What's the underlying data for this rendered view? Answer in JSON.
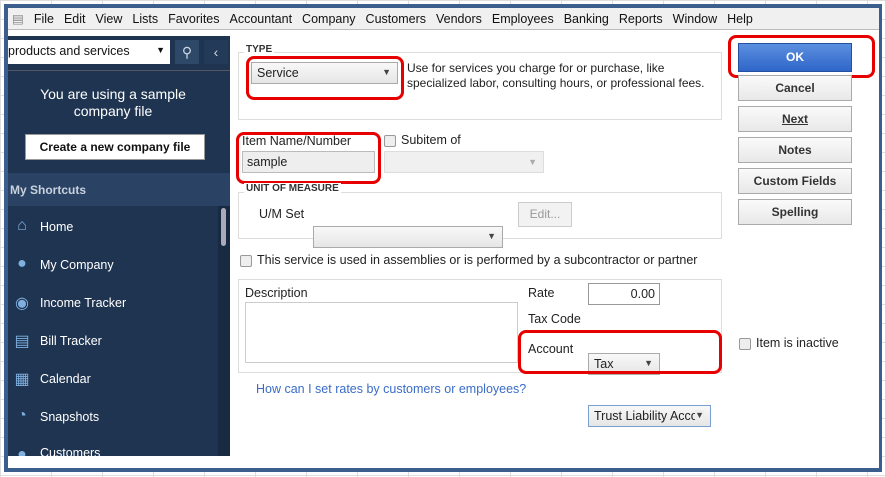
{
  "menu": [
    "File",
    "Edit",
    "View",
    "Lists",
    "Favorites",
    "Accountant",
    "Company",
    "Customers",
    "Vendors",
    "Employees",
    "Banking",
    "Reports",
    "Window",
    "Help"
  ],
  "sidebar": {
    "search_value": "products and services",
    "sample_msg": "You are using a sample company file",
    "create_btn": "Create a new company file",
    "shortcuts_title": "My Shortcuts",
    "items": [
      {
        "label": "Home",
        "icon": "home-icon"
      },
      {
        "label": "My Company",
        "icon": "company-icon"
      },
      {
        "label": "Income Tracker",
        "icon": "income-icon"
      },
      {
        "label": "Bill Tracker",
        "icon": "bill-icon"
      },
      {
        "label": "Calendar",
        "icon": "calendar-icon"
      },
      {
        "label": "Snapshots",
        "icon": "pie-icon"
      },
      {
        "label": "Customers",
        "icon": "customers-icon"
      }
    ]
  },
  "form": {
    "type_label": "TYPE",
    "type_value": "Service",
    "type_desc": "Use for services you charge for or purchase, like specialized labor, consulting hours, or professional fees.",
    "item_name_label": "Item Name/Number",
    "item_name_value": "sample",
    "subitem_label": "Subitem of",
    "uom_label": "UNIT OF MEASURE",
    "um_set_label": "U/M Set",
    "edit_btn": "Edit...",
    "assemblies_label": "This service is used in assemblies or is performed by a subcontractor or partner",
    "description_label": "Description",
    "rate_label": "Rate",
    "rate_value": "0.00",
    "tax_code_label": "Tax Code",
    "tax_code_value": "Tax",
    "account_label": "Account",
    "account_value": "Trust Liability Acco",
    "help_link": "How can I set rates by customers or employees?",
    "inactive_label": "Item is inactive"
  },
  "buttons": {
    "ok": "OK",
    "cancel": "Cancel",
    "next": "Next",
    "notes": "Notes",
    "custom_fields": "Custom Fields",
    "spelling": "Spelling"
  }
}
